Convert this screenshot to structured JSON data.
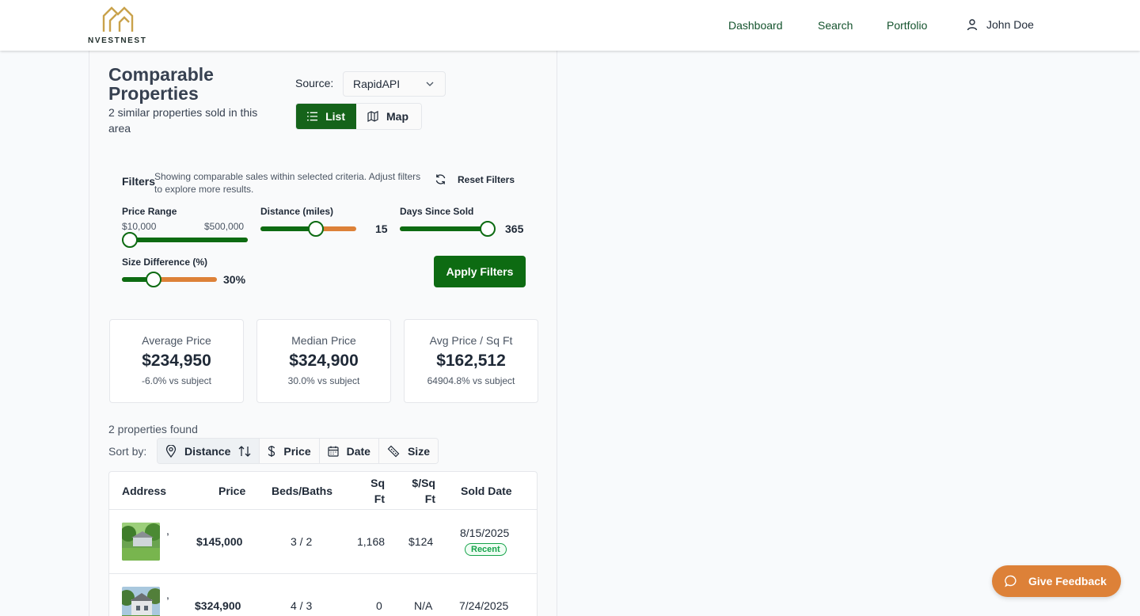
{
  "header": {
    "logo_text": "NVESTNEST",
    "nav": {
      "dashboard": "Dashboard",
      "search": "Search",
      "portfolio": "Portfolio",
      "user": "John Doe"
    }
  },
  "panel": {
    "title": "Comparable Properties",
    "subtitle": "2 similar properties sold in this area",
    "source_label": "Source:",
    "source_value": "RapidAPI",
    "view_list": "List",
    "view_map": "Map"
  },
  "filters": {
    "title": "Filters",
    "description": "Showing comparable sales within selected criteria. Adjust filters to explore more results.",
    "reset_label": "Reset Filters",
    "price_range": {
      "label": "Price Range",
      "min_label": "$10,000",
      "max_label": "$500,000",
      "level": 0.0
    },
    "distance": {
      "label": "Distance (miles)",
      "value": "15",
      "level": 0.58
    },
    "days_since_sold": {
      "label": "Days Since Sold",
      "value": "365",
      "level": 1.0
    },
    "size_difference": {
      "label": "Size Difference (%)",
      "value": "30%",
      "level": 0.33
    },
    "apply_label": "Apply Filters"
  },
  "stats": [
    {
      "label": "Average Price",
      "value": "$234,950",
      "note": "-6.0% vs subject"
    },
    {
      "label": "Median Price",
      "value": "$324,900",
      "note": "30.0% vs subject"
    },
    {
      "label": "Avg Price / Sq Ft",
      "value": "$162,512",
      "note": "64904.8% vs subject"
    }
  ],
  "results": {
    "found": "2 properties found",
    "sort_label": "Sort by:",
    "sort_options": [
      "Distance",
      "Price",
      "Date",
      "Size"
    ]
  },
  "table": {
    "headers": {
      "address": "Address",
      "price": "Price",
      "beds_baths": "Beds/Baths",
      "sqft_1": "Sq",
      "sqft_2": "Ft",
      "ppsf_1": "$/Sq",
      "ppsf_2": "Ft",
      "sold_date": "Sold Date"
    },
    "rows": [
      {
        "address": ",",
        "price": "$145,000",
        "beds_baths": "3 / 2",
        "sqft": "1,168",
        "ppsf": "$124",
        "sold_date": "8/15/2025",
        "badge": "Recent"
      },
      {
        "address": ",",
        "price": "$324,900",
        "beds_baths": "4 / 3",
        "sqft": "0",
        "ppsf": "N/A",
        "sold_date": "7/24/2025",
        "badge": ""
      }
    ]
  },
  "feedback_label": "Give Feedback",
  "colors": {
    "brand_green": "#0d6b12",
    "accent_orange": "#dd8138",
    "logo_gold": "#c9a24b"
  }
}
